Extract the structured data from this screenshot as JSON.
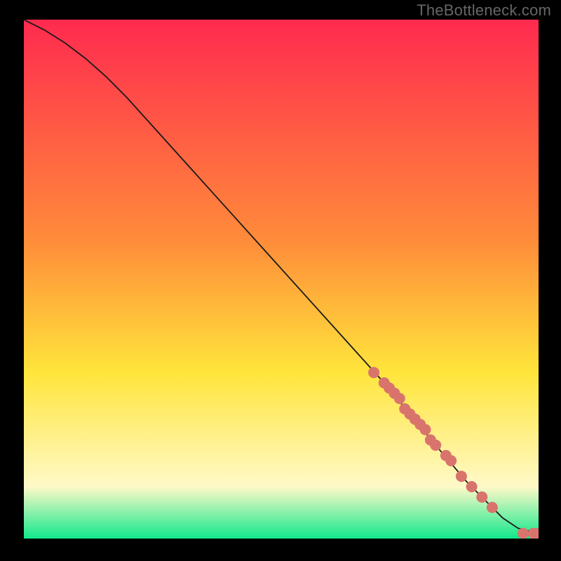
{
  "watermark": "TheBottleneck.com",
  "gradient_colors": {
    "top": "#ff2a4f",
    "upper_mid": "#ff8a3a",
    "mid": "#ffe53b",
    "lower_mid": "#fff9c8",
    "bottom": "#12e88c"
  },
  "point_color": "#d9746d",
  "curve_color": "#1a1a1a",
  "chart_data": {
    "type": "line",
    "title": "",
    "xlabel": "",
    "ylabel": "",
    "xlim": [
      0,
      100
    ],
    "ylim": [
      0,
      100
    ],
    "series": [
      {
        "name": "curve",
        "x": [
          0,
          4,
          8,
          12,
          16,
          20,
          30,
          40,
          50,
          60,
          70,
          80,
          86,
          90,
          93,
          96,
          100
        ],
        "y": [
          100,
          98,
          95.5,
          92.5,
          89,
          85,
          74,
          63,
          52,
          41,
          30,
          18,
          11,
          7,
          4,
          2,
          1
        ]
      },
      {
        "name": "points",
        "x": [
          68,
          70,
          71,
          72,
          73,
          74,
          75,
          76,
          77,
          78,
          79,
          80,
          82,
          83,
          85,
          87,
          89,
          91,
          97,
          99,
          100
        ],
        "y": [
          32,
          30,
          29,
          28,
          27,
          25,
          24,
          23,
          22,
          21,
          19,
          18,
          16,
          15,
          12,
          10,
          8,
          6,
          1,
          1,
          1
        ]
      }
    ]
  }
}
